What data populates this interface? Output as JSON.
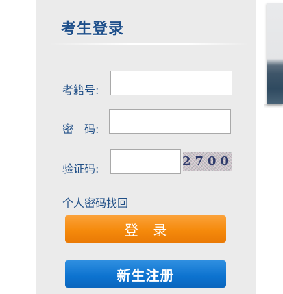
{
  "login": {
    "title": "考生登录",
    "username_label": "考籍号:",
    "password_label": "密　码:",
    "captcha_label": "验证码:",
    "username_value": "",
    "password_value": "",
    "captcha_value": "",
    "captcha_code": "2700",
    "forgot_password": "个人密码找回",
    "login_button": "登 录",
    "register_button": "新生注册"
  },
  "colors": {
    "panel_bg": "#ebebeb",
    "label_text": "#1f4e86",
    "login_button": "#f58a0c",
    "register_button": "#0c72cf"
  }
}
